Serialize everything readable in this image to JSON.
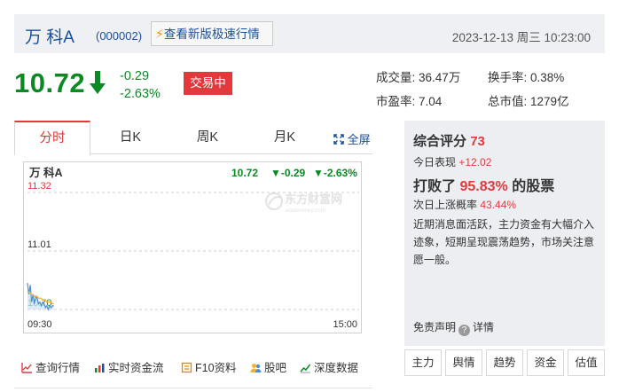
{
  "header": {
    "stock_name": "万 科A",
    "stock_code": "(000002)",
    "express_label": "查看新版极速行情",
    "datetime": "2023-12-13 周三 10:23:00"
  },
  "quote": {
    "price": "10.72",
    "change": "-0.29",
    "change_pct": "-2.63%",
    "status": "交易中",
    "price_color": "#0b8a24"
  },
  "stats": {
    "volume_label": "成交量:",
    "volume": "36.47万",
    "turnover_label": "换手率:",
    "turnover": "0.38%",
    "pe_label": "市盈率:",
    "pe": "7.04",
    "mcap_label": "总市值:",
    "mcap": "1279亿"
  },
  "tabs": {
    "t1": "分时",
    "t2": "日K",
    "t3": "周K",
    "t4": "月K",
    "fullscreen": "全屏",
    "active": "分时"
  },
  "chart_data": {
    "type": "line",
    "title": "万 科A",
    "header_price": "10.72",
    "header_change": "▼-0.29",
    "header_pct": "▼-2.63%",
    "watermark": "东方财富网",
    "watermark_sub": "eastmoney.com",
    "y_labels": [
      "11.32",
      "11.01",
      "10.70"
    ],
    "x_labels": [
      "09:30",
      "15:00"
    ],
    "ylim": [
      10.7,
      11.32
    ],
    "prev_close": 11.01,
    "grid": "dashed horizontal",
    "series": [
      {
        "values": [
          10.84,
          10.78,
          10.83,
          10.74,
          10.78,
          10.73,
          10.77,
          10.76,
          10.73,
          10.74,
          10.72,
          10.74,
          10.73,
          10.71,
          10.72,
          10.7,
          10.72,
          10.71,
          10.72,
          10.72
        ],
        "color": "#4a90d9"
      },
      {
        "values": [
          10.8,
          10.79,
          10.79,
          10.78,
          10.78,
          10.77,
          10.77,
          10.77,
          10.76,
          10.76,
          10.76,
          10.75,
          10.75,
          10.75,
          10.74,
          10.74,
          10.74,
          10.74,
          10.73,
          10.73
        ],
        "color": "#f2b233"
      }
    ]
  },
  "panel": {
    "score_label": "综合评分",
    "score": "73",
    "today_label": "今日表现",
    "today_value": "+12.02",
    "beat_prefix": "打败了",
    "beat_pct": "95.83%",
    "beat_suffix": "的股票",
    "prob_label": "次日上涨概率",
    "prob_value": "43.44%",
    "comment": "近期消息面活跃，主力资金有大幅介入迹象，短期呈现震荡趋势，市场关注意愿一般。",
    "disclaimer_label": "免责声明",
    "details_label": "详情",
    "buttons": [
      "主力",
      "舆情",
      "趋势",
      "资金",
      "估值"
    ]
  },
  "links": {
    "l1": "查询行情",
    "l2": "实时资金流",
    "l3": "F10资料",
    "l4": "股吧",
    "l5": "深度数据"
  }
}
